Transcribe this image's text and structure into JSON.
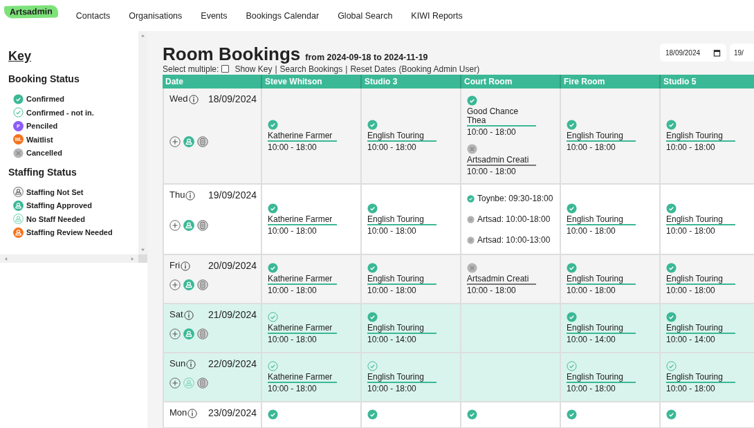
{
  "nav": {
    "logo": "Artsadmin",
    "items": [
      "Contacts",
      "Organisations",
      "Events",
      "Bookings Calendar",
      "Global Search",
      "KIWI Reports"
    ]
  },
  "key": {
    "title": "Key",
    "booking_status": {
      "title": "Booking Status",
      "items": [
        {
          "kind": "confirmed",
          "label": "Confirmed"
        },
        {
          "kind": "confirmed_not_in",
          "label": "Confirmed - not in."
        },
        {
          "kind": "penciled",
          "label": "Penciled",
          "badge": "P"
        },
        {
          "kind": "waitlist",
          "label": "Waitlist",
          "badge": "WL"
        },
        {
          "kind": "cancelled",
          "label": "Cancelled"
        }
      ]
    },
    "staffing_status": {
      "title": "Staffing Status",
      "items": [
        {
          "kind": "not_set",
          "label": "Staffing Not Set"
        },
        {
          "kind": "approved",
          "label": "Staffing Approved"
        },
        {
          "kind": "not_needed",
          "label": "No Staff Needed"
        },
        {
          "kind": "review",
          "label": "Staffing Review Needed"
        }
      ]
    }
  },
  "page": {
    "title": "Room Bookings",
    "range": "from 2024-09-18 to 2024-11-19",
    "date_fields": [
      {
        "value": "18/09/2024",
        "calendar": true
      },
      {
        "value": "19/",
        "calendar": false
      }
    ],
    "select_multiple": {
      "label": "Select multiple:",
      "checked": false
    },
    "links": [
      "Show Key",
      "Search Bookings",
      "Reset Dates"
    ],
    "separators": [
      "|",
      "|"
    ],
    "user": "(Booking Admin User)"
  },
  "table": {
    "date_column": "Date",
    "room_columns": [
      "Steve Whitson",
      "Studio 3",
      "Court Room",
      "Fire Room",
      "Studio 5"
    ],
    "rows": [
      {
        "day": "Wed",
        "date": "18/09/2024",
        "weekend": false,
        "staffing": {
          "kind": "approved"
        },
        "cells": [
          [
            {
              "kind": "confirmed",
              "name": "Katherine Farmer",
              "time": "10:00 - 18:00"
            }
          ],
          [
            {
              "kind": "confirmed",
              "name": "English Touring",
              "time": "10:00 - 18:00"
            }
          ],
          [
            {
              "kind": "confirmed",
              "name": "Good Chance Thea",
              "time": "10:00 - 18:00"
            },
            {
              "kind": "cancelled",
              "name": "Artsadmin Creati",
              "time": "10:00 - 18:00"
            }
          ],
          [
            {
              "kind": "confirmed",
              "name": "English Touring",
              "time": "10:00 - 18:00"
            }
          ],
          [
            {
              "kind": "confirmed",
              "name": "English Touring",
              "time": "10:00 - 18:00"
            }
          ]
        ]
      },
      {
        "day": "Thu",
        "date": "19/09/2024",
        "weekend": false,
        "staffing": {
          "kind": "approved"
        },
        "cells": [
          [
            {
              "kind": "confirmed",
              "name": "Katherine Farmer",
              "time": "10:00 - 18:00"
            }
          ],
          [
            {
              "kind": "confirmed",
              "name": "English Touring",
              "time": "10:00 - 18:00"
            }
          ],
          [
            {
              "kind": "confirmed",
              "text": "Toynbe: 09:30-18:00"
            },
            {
              "kind": "cancelled",
              "text": "Artsad: 10:00-18:00"
            },
            {
              "kind": "cancelled",
              "text": "Artsad: 10:00-13:00"
            }
          ],
          [
            {
              "kind": "confirmed",
              "name": "English Touring",
              "time": "10:00 - 18:00"
            }
          ],
          [
            {
              "kind": "confirmed",
              "name": "English Touring",
              "time": "10:00 - 18:00"
            }
          ]
        ]
      },
      {
        "day": "Fri",
        "date": "20/09/2024",
        "weekend": false,
        "staffing": {
          "kind": "approved"
        },
        "cells": [
          [
            {
              "kind": "confirmed",
              "name": "Katherine Farmer",
              "time": "10:00 - 18:00"
            }
          ],
          [
            {
              "kind": "confirmed",
              "name": "English Touring",
              "time": "10:00 - 18:00"
            }
          ],
          [
            {
              "kind": "cancelled",
              "name": "Artsadmin Creati",
              "time": "10:00 - 18:00"
            }
          ],
          [
            {
              "kind": "confirmed",
              "name": "English Touring",
              "time": "10:00 - 18:00"
            }
          ],
          [
            {
              "kind": "confirmed",
              "name": "English Touring",
              "time": "10:00 - 18:00"
            }
          ]
        ]
      },
      {
        "day": "Sat",
        "date": "21/09/2024",
        "weekend": true,
        "staffing": {
          "kind": "approved"
        },
        "cells": [
          [
            {
              "kind": "confirmed_not_in",
              "name": "Katherine Farmer",
              "time": "10:00 - 18:00"
            }
          ],
          [
            {
              "kind": "confirmed",
              "name": "English Touring",
              "time": "10:00 - 14:00"
            }
          ],
          [],
          [
            {
              "kind": "confirmed",
              "name": "English Touring",
              "time": "10:00 - 14:00"
            }
          ],
          [
            {
              "kind": "confirmed",
              "name": "English Touring",
              "time": "10:00 - 14:00"
            }
          ]
        ]
      },
      {
        "day": "Sun",
        "date": "22/09/2024",
        "weekend": true,
        "staffing": {
          "kind": "not_needed"
        },
        "cells": [
          [
            {
              "kind": "confirmed_not_in",
              "name": "Katherine Farmer",
              "time": "10:00 - 18:00"
            }
          ],
          [
            {
              "kind": "confirmed_not_in",
              "name": "English Touring",
              "time": "10:00 - 18:00"
            }
          ],
          [],
          [
            {
              "kind": "confirmed_not_in",
              "name": "English Touring",
              "time": "10:00 - 18:00"
            }
          ],
          [
            {
              "kind": "confirmed_not_in",
              "name": "English Touring",
              "time": "10:00 - 18:00"
            }
          ]
        ]
      },
      {
        "day": "Mon",
        "date": "23/09/2024",
        "weekend": false,
        "cells": [
          [
            {
              "kind": "confirmed"
            }
          ],
          [
            {
              "kind": "confirmed"
            }
          ],
          [
            {
              "kind": "confirmed"
            }
          ],
          [
            {
              "kind": "confirmed"
            }
          ],
          [
            {
              "kind": "confirmed"
            }
          ]
        ]
      }
    ]
  }
}
